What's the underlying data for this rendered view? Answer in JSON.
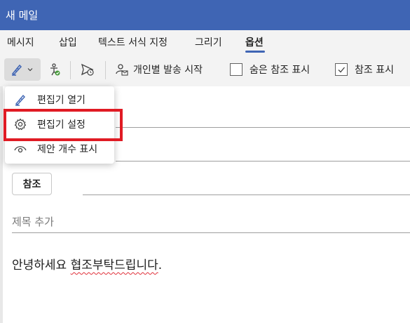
{
  "window": {
    "title": "새 메일"
  },
  "tabs": [
    {
      "label": "메시지"
    },
    {
      "label": "삽입"
    },
    {
      "label": "텍스트 서식 지정"
    },
    {
      "label": "그리기"
    },
    {
      "label": "옵션",
      "active": true
    }
  ],
  "ribbon": {
    "personal_send_label": "개인별 발송 시작",
    "hidden_cc": {
      "label": "숨은 참조 표시",
      "checked": false
    },
    "cc": {
      "label": "참조 표시",
      "checked": true
    }
  },
  "menu": {
    "items": [
      {
        "label": "편집기 열기",
        "icon": "pen-icon"
      },
      {
        "label": "편집기 설정",
        "icon": "gear-icon"
      },
      {
        "label": "제안 개수 표시",
        "icon": "eye-icon"
      }
    ]
  },
  "compose": {
    "cc_button_label": "참조",
    "subject_placeholder": "제목 추가",
    "body_prefix": "안녕하세요 ",
    "body_misspelled": "협조부탁드립니다",
    "body_suffix": "."
  },
  "colors": {
    "accent": "#3f65b4",
    "highlight": "#e01b24",
    "spellcheck": "#e0303a"
  }
}
